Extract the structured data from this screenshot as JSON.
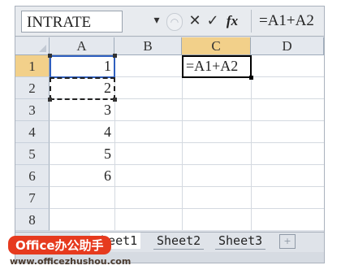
{
  "formula_bar": {
    "name_box": "INTRATE",
    "dropdown_glyph": "▾",
    "round_glyph": "◠",
    "cancel_glyph": "✕",
    "enter_glyph": "✓",
    "fx_glyph": "fx",
    "formula": "=A1+A2"
  },
  "columns": [
    "A",
    "B",
    "C",
    "D"
  ],
  "rows": [
    "1",
    "2",
    "3",
    "4",
    "5",
    "6",
    "7",
    "8"
  ],
  "cells": {
    "A": [
      "1",
      "2",
      "3",
      "4",
      "5",
      "6",
      "",
      ""
    ],
    "C1": "=A1+A2"
  },
  "sheet_tabs": [
    "Sheet1",
    "Sheet2",
    "Sheet3"
  ],
  "tab_nav_glyphs": [
    "◀",
    "◂",
    "▸",
    "▶"
  ],
  "new_sheet_glyph": "+",
  "watermark": {
    "badge": "Office办公助手",
    "url": "www.officezhushou.com"
  },
  "colors": {
    "selected_header": "#f2d08a",
    "marquee": "#222222",
    "watermark_red": "#e63a1e"
  }
}
